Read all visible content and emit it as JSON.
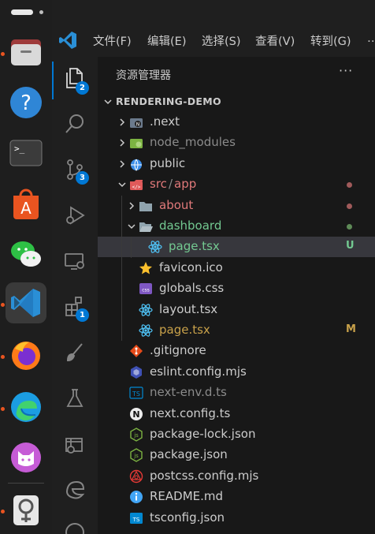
{
  "colors": {
    "accent": "#0078d4",
    "modified": "#c8a14a",
    "untracked": "#73c991",
    "dot_red": "#a05a5a",
    "dot_green": "#5e8a57"
  },
  "menu": [
    "文件(F)",
    "编辑(E)",
    "选择(S)",
    "查看(V)",
    "转到(G)",
    "…"
  ],
  "activity_badges": {
    "explorer": "2",
    "source_control": "3",
    "extensions": "1"
  },
  "sidebar": {
    "title": "资源管理器",
    "more": "···",
    "project": "RENDERING-DEMO"
  },
  "tree": [
    {
      "name": ".next",
      "icon": "next-folder-icon",
      "depth": 1,
      "chevron": "right",
      "color": "#cccccc"
    },
    {
      "name": "node_modules",
      "icon": "node-folder-icon",
      "depth": 1,
      "chevron": "right",
      "color": "#8b8b8b"
    },
    {
      "name": "public",
      "icon": "globe-folder-icon",
      "depth": 1,
      "chevron": "right",
      "color": "#cccccc"
    },
    {
      "name": "src",
      "sep": "/",
      "name2": "app",
      "icon": "src-folder-icon",
      "depth": 1,
      "chevron": "down",
      "color": "#e0797a",
      "status": "dot-red"
    },
    {
      "name": "about",
      "icon": "folder-icon",
      "depth": 2,
      "chevron": "right",
      "color": "#e0797a",
      "status": "dot-red"
    },
    {
      "name": "dashboard",
      "icon": "folder-open-icon",
      "depth": 2,
      "chevron": "down",
      "color": "#73c991",
      "status": "dot-green"
    },
    {
      "name": "page.tsx",
      "icon": "react-icon",
      "depth": 3,
      "color": "#73c991",
      "status": "U",
      "selected": true
    },
    {
      "name": "favicon.ico",
      "icon": "star-icon",
      "depth": 2,
      "color": "#cccccc"
    },
    {
      "name": "globals.css",
      "icon": "css-icon",
      "depth": 2,
      "color": "#cccccc"
    },
    {
      "name": "layout.tsx",
      "icon": "react-icon",
      "depth": 2,
      "color": "#cccccc"
    },
    {
      "name": "page.tsx",
      "icon": "react-icon",
      "depth": 2,
      "color": "#c8a14a",
      "status": "M"
    },
    {
      "name": ".gitignore",
      "icon": "git-icon",
      "depth": 1,
      "color": "#cccccc"
    },
    {
      "name": "eslint.config.mjs",
      "icon": "eslint-icon",
      "depth": 1,
      "color": "#cccccc"
    },
    {
      "name": "next-env.d.ts",
      "icon": "ts-icon",
      "depth": 1,
      "color": "#8b8b8b"
    },
    {
      "name": "next.config.ts",
      "icon": "next-icon",
      "depth": 1,
      "color": "#cccccc"
    },
    {
      "name": "package-lock.json",
      "icon": "node-icon",
      "depth": 1,
      "color": "#cccccc"
    },
    {
      "name": "package.json",
      "icon": "node-icon",
      "depth": 1,
      "color": "#cccccc"
    },
    {
      "name": "postcss.config.mjs",
      "icon": "postcss-icon",
      "depth": 1,
      "color": "#cccccc"
    },
    {
      "name": "README.md",
      "icon": "info-icon",
      "depth": 1,
      "color": "#cccccc"
    },
    {
      "name": "tsconfig.json",
      "icon": "tsconfig-icon",
      "depth": 1,
      "color": "#cccccc"
    }
  ]
}
